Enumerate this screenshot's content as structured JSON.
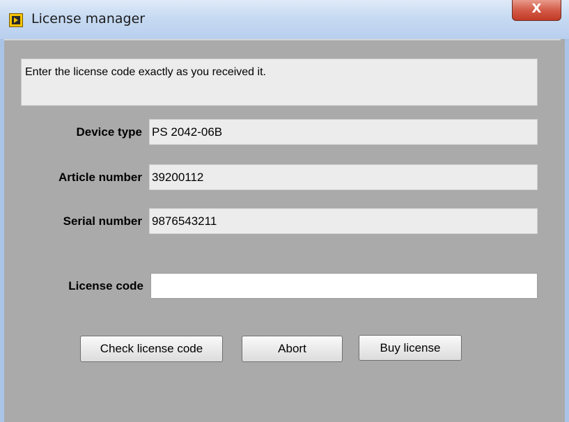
{
  "window": {
    "title": "License manager",
    "close_glyph": "X",
    "icon": "labview-app-icon"
  },
  "message": "Enter the license code exactly as you received it.",
  "fields": {
    "device_type": {
      "label": "Device type",
      "value": "PS 2042-06B"
    },
    "article_number": {
      "label": "Article number",
      "value": "39200112"
    },
    "serial_number": {
      "label": "Serial number",
      "value": "9876543211"
    },
    "license_code": {
      "label": "License code",
      "value": "",
      "placeholder": ""
    }
  },
  "buttons": {
    "check": "Check license code",
    "abort": "Abort",
    "buy": "Buy license"
  }
}
